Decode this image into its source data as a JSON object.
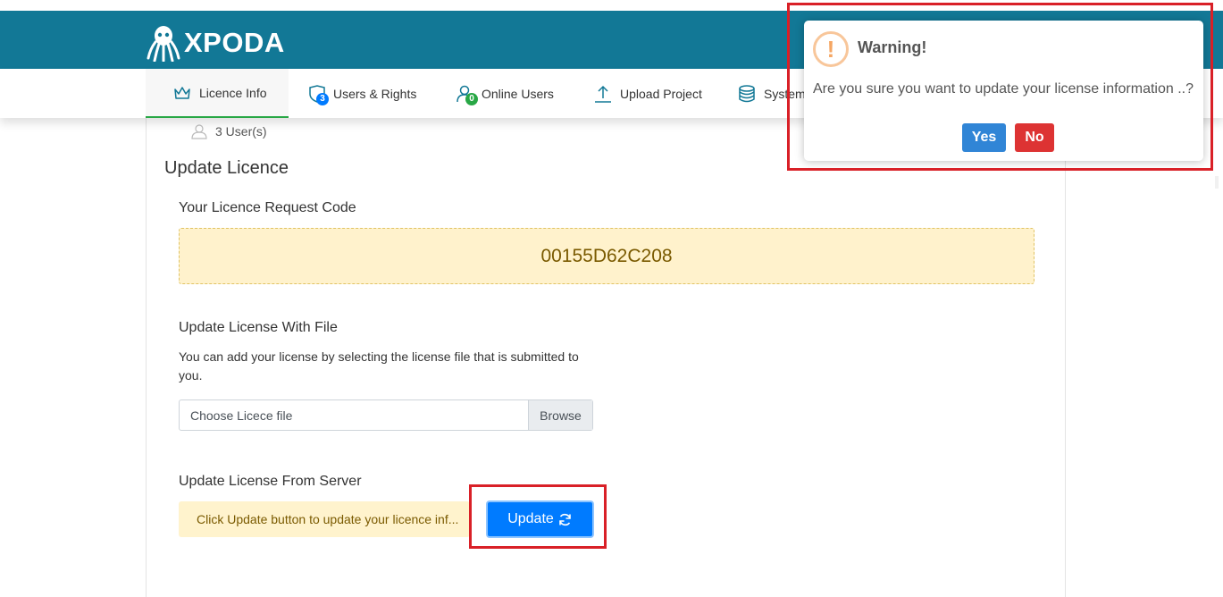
{
  "header": {
    "logo_text": "XPODA",
    "bg_color": "#127896"
  },
  "nav": {
    "items": [
      {
        "label": "Licence Info",
        "icon": "crown-icon",
        "active": true
      },
      {
        "label": "Users & Rights",
        "icon": "shield-users-icon",
        "badge": "3",
        "badge_color": "#007bff"
      },
      {
        "label": "Online Users",
        "icon": "user-online-icon",
        "badge": "0",
        "badge_color": "#28a745"
      },
      {
        "label": "Upload Project",
        "icon": "upload-icon"
      },
      {
        "label": "System",
        "icon": "database-icon"
      }
    ]
  },
  "main": {
    "users_count": "3 User(s)",
    "section_title": "Update Licence",
    "request_code_label": "Your Licence Request Code",
    "request_code": "00155D62C208",
    "file_section": {
      "title": "Update License With File",
      "description": "You can add your license by selecting the license file that is submitted to you.",
      "placeholder": "Choose Licece file",
      "browse_label": "Browse"
    },
    "server_section": {
      "title": "Update License From Server",
      "message": "Click Update button to update your licence inf...",
      "update_label": "Update"
    }
  },
  "dialog": {
    "title": "Warning!",
    "message": "Are you sure you want to update your license information ..?",
    "yes_label": "Yes",
    "no_label": "No",
    "icon": "warning-icon"
  },
  "colors": {
    "accent_green": "#28a745",
    "primary_blue": "#007bff",
    "confirm_blue": "#3085d6",
    "danger_red": "#dd3333",
    "highlight_red": "#d92027"
  }
}
